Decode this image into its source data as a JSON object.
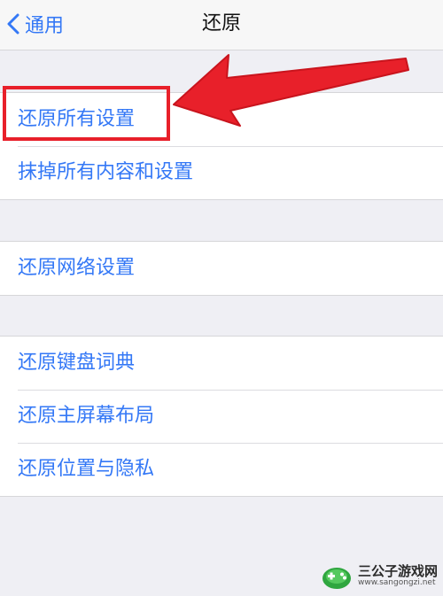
{
  "nav": {
    "back_label": "通用",
    "title": "还原"
  },
  "groups": [
    [
      "还原所有设置",
      "抹掉所有内容和设置"
    ],
    [
      "还原网络设置"
    ],
    [
      "还原键盘词典",
      "还原主屏幕布局",
      "还原位置与隐私"
    ]
  ],
  "colors": {
    "accent": "#3478f6",
    "background": "#efeff4",
    "annotation": "#e8202a"
  },
  "icons": {
    "back": "chevron-left-icon",
    "annotation": "red-arrow-icon",
    "watermark": "game-controller-logo-icon"
  },
  "watermark": {
    "name": "三公子游戏网",
    "url": "www.sangongzi.net"
  }
}
